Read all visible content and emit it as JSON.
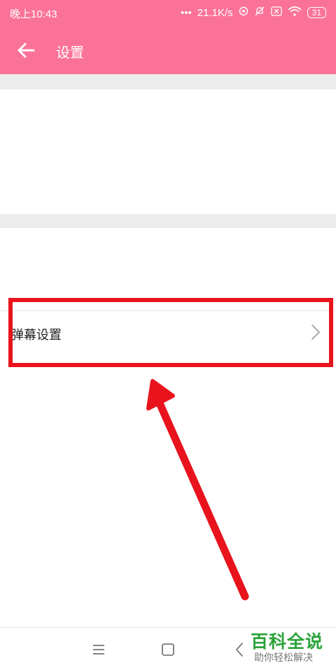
{
  "status_bar": {
    "time": "晚上10:43",
    "dots": "•••",
    "network_speed": "21.1K/s",
    "battery": "31"
  },
  "app_bar": {
    "title": "设置",
    "background": "#fb7299"
  },
  "settings": {
    "danmaku_label": "弹幕设置"
  },
  "annotation": {
    "highlight_color": "#e8131c"
  },
  "watermark": {
    "title": "百科全说",
    "subtitle": "助你轻松解决"
  }
}
